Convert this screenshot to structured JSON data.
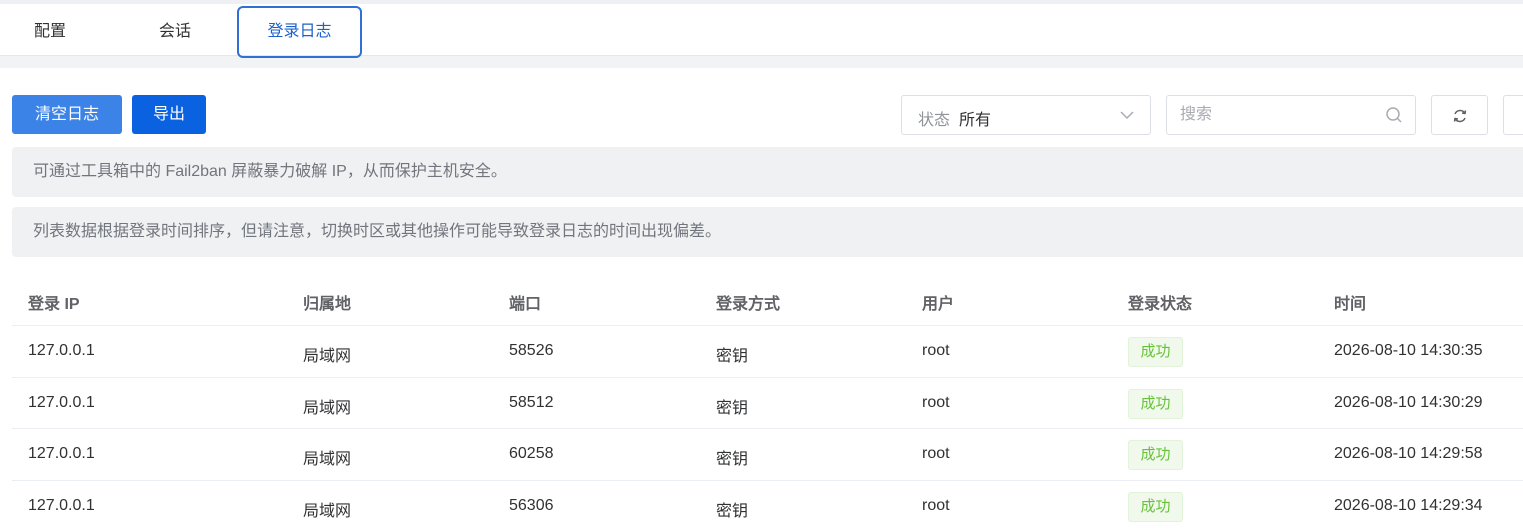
{
  "tabs": [
    {
      "label": "配置",
      "active": false
    },
    {
      "label": "会话",
      "active": false
    },
    {
      "label": "登录日志",
      "active": true
    }
  ],
  "toolbar": {
    "clear_label": "清空日志",
    "export_label": "导出",
    "status_label": "状态",
    "status_value": "所有",
    "search_placeholder": "搜索"
  },
  "notices": [
    "可通过工具箱中的 Fail2ban 屏蔽暴力破解 IP，从而保护主机安全。",
    "列表数据根据登录时间排序，但请注意，切换时区或其他操作可能导致登录日志的时间出现偏差。"
  ],
  "table": {
    "columns": [
      "登录 IP",
      "归属地",
      "端口",
      "登录方式",
      "用户",
      "登录状态",
      "时间"
    ],
    "rows": [
      {
        "ip": "127.0.0.1",
        "location": "局域网",
        "port": "58526",
        "method": "密钥",
        "user": "root",
        "status": "成功",
        "time": "2026-08-10 14:30:35"
      },
      {
        "ip": "127.0.0.1",
        "location": "局域网",
        "port": "58512",
        "method": "密钥",
        "user": "root",
        "status": "成功",
        "time": "2026-08-10 14:30:29"
      },
      {
        "ip": "127.0.0.1",
        "location": "局域网",
        "port": "60258",
        "method": "密钥",
        "user": "root",
        "status": "成功",
        "time": "2026-08-10 14:29:58"
      },
      {
        "ip": "127.0.0.1",
        "location": "局域网",
        "port": "56306",
        "method": "密钥",
        "user": "root",
        "status": "成功",
        "time": "2026-08-10 14:29:34"
      }
    ]
  },
  "colors": {
    "primary": "#0a62e0",
    "primary_light": "#3c83e8",
    "success": "#67c23a"
  },
  "icons": [
    "chevron-down-icon",
    "search-icon",
    "refresh-icon"
  ]
}
